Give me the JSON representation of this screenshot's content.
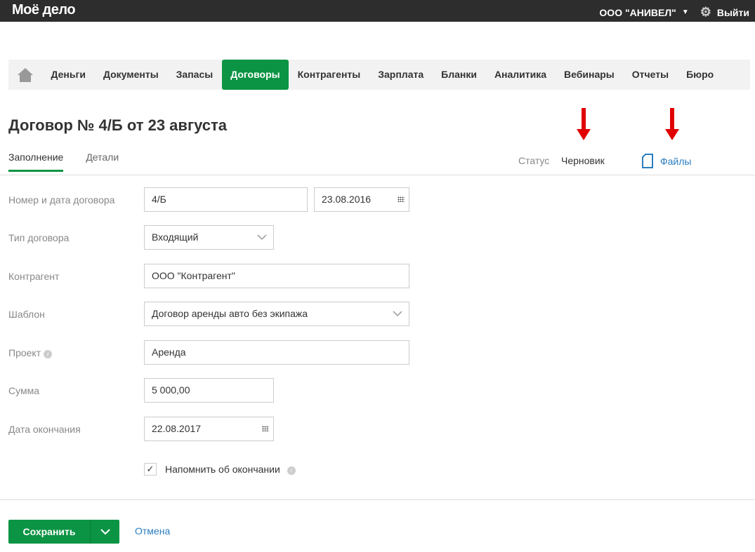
{
  "header": {
    "logo": "Моё дело",
    "company": "ООО \"АНИВЕЛ\"",
    "logout": "Выйти"
  },
  "nav": {
    "items": [
      "Деньги",
      "Документы",
      "Запасы",
      "Договоры",
      "Контрагенты",
      "Зарплата",
      "Бланки",
      "Аналитика",
      "Вебинары",
      "Отчеты",
      "Бюро"
    ],
    "active": "Договоры"
  },
  "page": {
    "title": "Договор № 4/Б от 23 августа",
    "tabs": [
      "Заполнение",
      "Детали"
    ],
    "status_label": "Статус",
    "status_value": "Черновик",
    "files": "Файлы"
  },
  "form": {
    "number_label": "Номер и дата договора",
    "number": "4/Б",
    "date": "23.08.2016",
    "type_label": "Тип договора",
    "type": "Входящий",
    "counterparty_label": "Контрагент",
    "counterparty": "ООО \"Контрагент\"",
    "template_label": "Шаблон",
    "template": "Договор аренды авто без экипажа",
    "project_label": "Проект",
    "project": "Аренда",
    "sum_label": "Сумма",
    "sum": "5 000,00",
    "end_label": "Дата окончания",
    "end_date": "22.08.2017",
    "remind_label": "Напомнить об окончании",
    "remind_checked": true
  },
  "footer": {
    "save": "Сохранить",
    "cancel": "Отмена"
  },
  "colors": {
    "accent": "#0b9444",
    "link": "#2b7ec0",
    "annotation_arrow": "#e00000"
  }
}
